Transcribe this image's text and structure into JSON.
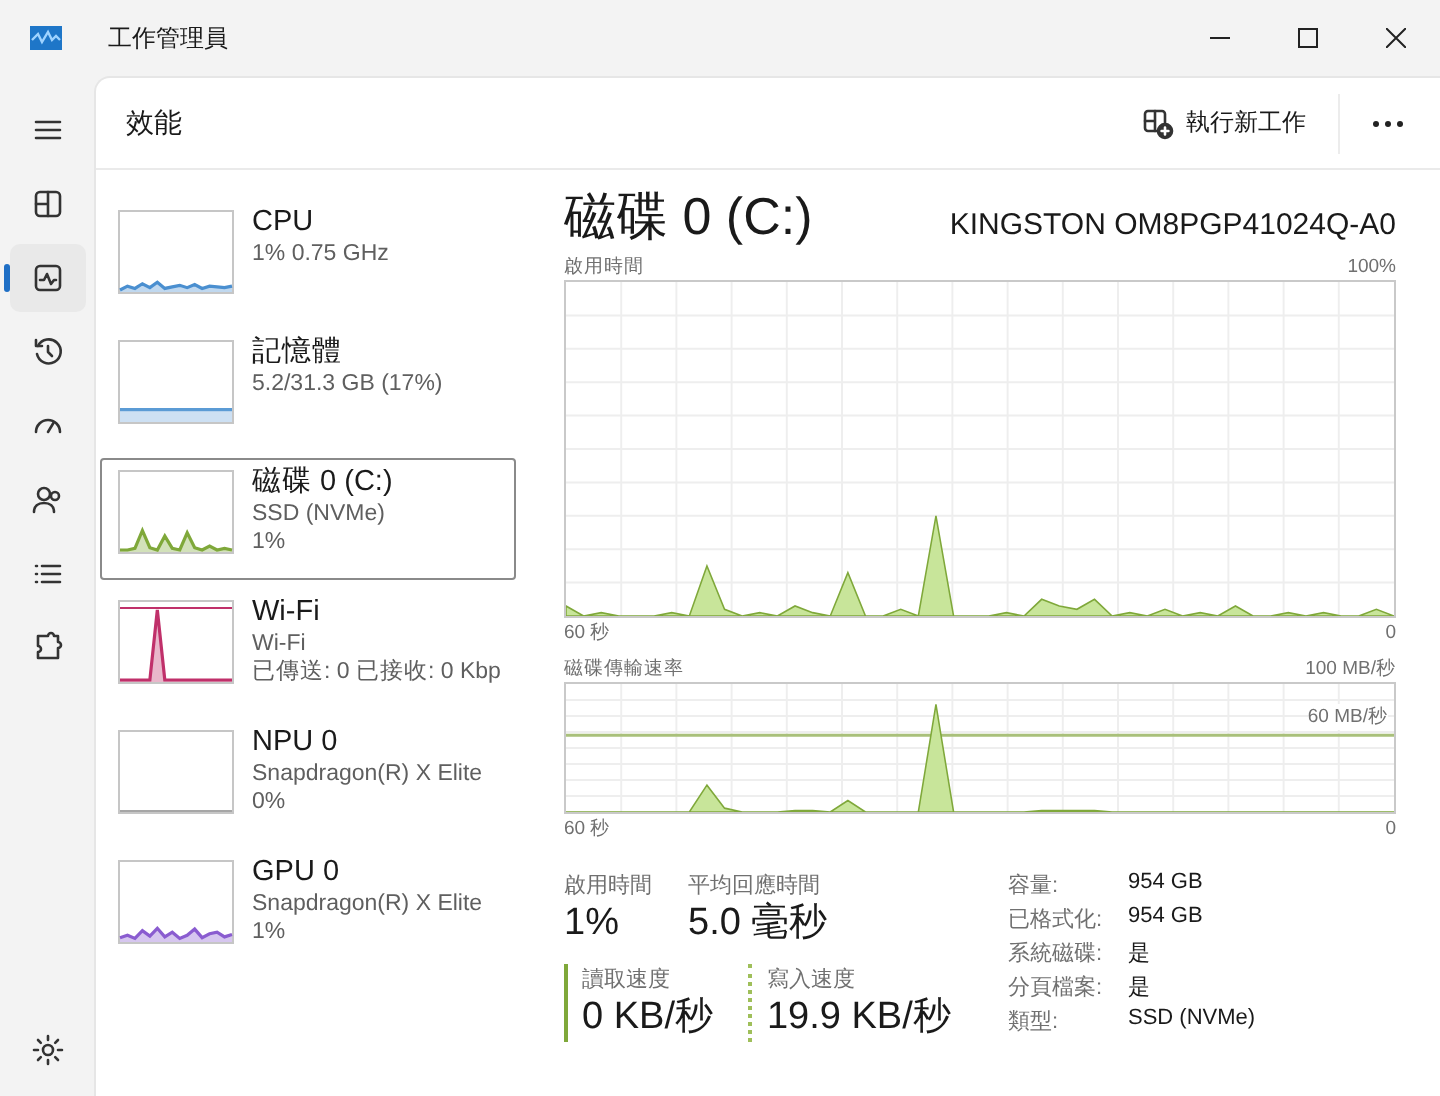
{
  "window": {
    "title": "工作管理員"
  },
  "nav": {
    "items": [
      {
        "selected": false
      },
      {
        "selected": true
      },
      {
        "selected": false
      },
      {
        "selected": false
      },
      {
        "selected": false
      },
      {
        "selected": false
      },
      {
        "selected": false
      },
      {
        "selected": false
      }
    ]
  },
  "header": {
    "title": "效能",
    "action": "執行新工作"
  },
  "devices": [
    {
      "name": "CPU",
      "lines": [
        "1% 0.75 GHz"
      ],
      "color": "#4a8fd0",
      "selected": false
    },
    {
      "name": "記憶體",
      "lines": [
        "5.2/31.3 GB (17%)"
      ],
      "color": "#5b9bd5",
      "selected": false
    },
    {
      "name": "磁碟 0 (C:)",
      "lines": [
        "SSD (NVMe)",
        "1%"
      ],
      "color": "#7fa83a",
      "selected": true
    },
    {
      "name": "Wi-Fi",
      "lines": [
        "Wi-Fi",
        "已傳送: 0 已接收: 0 Kbp"
      ],
      "color": "#c0306a",
      "selected": false
    },
    {
      "name": "NPU 0",
      "lines": [
        "Snapdragon(R) X Elite",
        "0%"
      ],
      "selected": false
    },
    {
      "name": "GPU 0",
      "lines": [
        "Snapdragon(R) X Elite",
        "1%"
      ],
      "color": "#8a5cd0",
      "selected": false
    }
  ],
  "detail": {
    "title": "磁碟 0 (C:)",
    "model": "KINGSTON OM8PGP41024Q-A0",
    "charts": [
      {
        "label": "啟用時間",
        "max": "100%",
        "time": "60 秒",
        "min": "0"
      },
      {
        "label": "磁碟傳輸速率",
        "max": "100 MB/秒",
        "marker": "60 MB/秒",
        "time": "60 秒",
        "min": "0"
      }
    ],
    "stats": [
      {
        "label": "啟用時間",
        "value": "1%"
      },
      {
        "label": "平均回應時間",
        "value": "5.0 毫秒"
      }
    ],
    "speeds": [
      {
        "kind": "read",
        "label": "讀取速度",
        "value": "0 KB/秒"
      },
      {
        "kind": "write",
        "label": "寫入速度",
        "value": "19.9 KB/秒"
      }
    ],
    "properties": [
      {
        "label": "容量:",
        "value": "954 GB"
      },
      {
        "label": "已格式化:",
        "value": "954 GB"
      },
      {
        "label": "系統磁碟:",
        "value": "是"
      },
      {
        "label": "分頁檔案:",
        "value": "是"
      },
      {
        "label": "類型:",
        "value": "SSD (NVMe)"
      }
    ]
  }
}
